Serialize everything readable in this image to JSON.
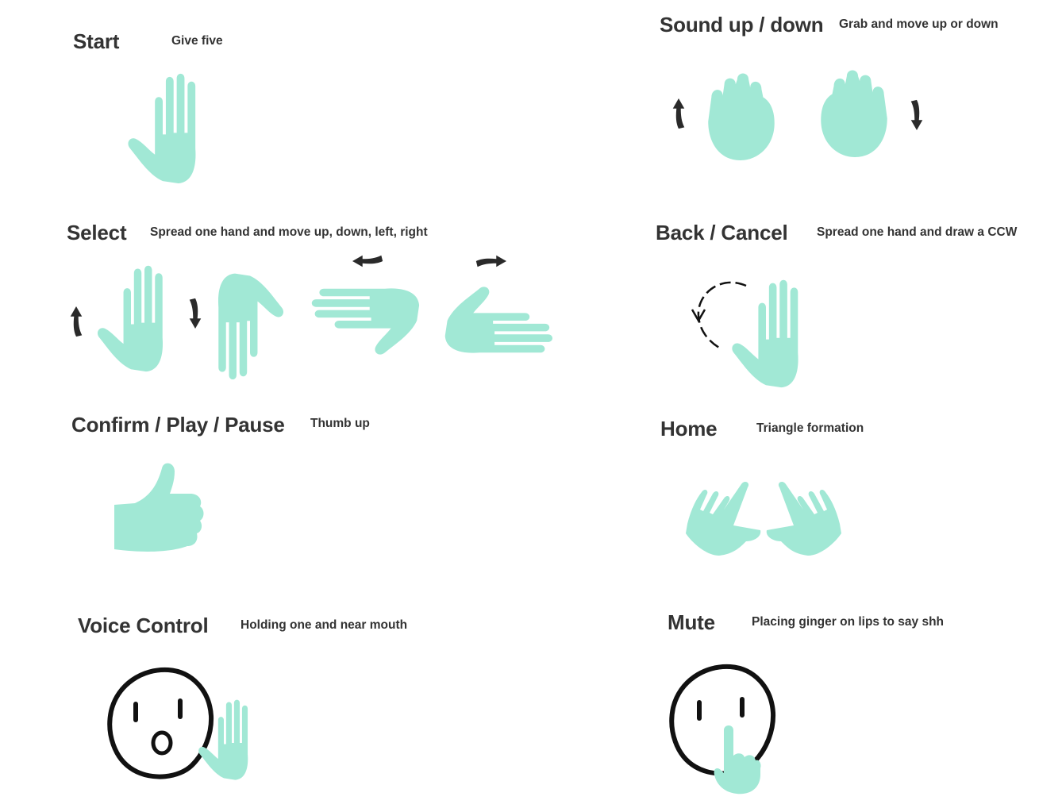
{
  "colors": {
    "hand": "#a1e8d5",
    "text": "#333333",
    "arrow": "#2a2a2a",
    "face": "#111111"
  },
  "gestures": [
    {
      "title": "Start",
      "description": "Give five",
      "icons": [
        "open-palm-hand-icon"
      ]
    },
    {
      "title": "Sound up / down",
      "description": "Grab and move up or down",
      "icons": [
        "grab-hand-icon",
        "rotate-up-arrow-icon",
        "rotate-down-arrow-icon"
      ]
    },
    {
      "title": "Select",
      "description": "Spread one hand and move up, down, left, right",
      "icons": [
        "hand-up-icon",
        "hand-down-icon",
        "hand-left-icon",
        "hand-right-icon"
      ]
    },
    {
      "title": "Back / Cancel",
      "description": "Spread one hand and draw a CCW",
      "icons": [
        "open-palm-hand-icon",
        "ccw-circle-arrow-icon"
      ]
    },
    {
      "title": "Confirm / Play / Pause",
      "description": "Thumb up",
      "icons": [
        "thumbs-up-icon"
      ]
    },
    {
      "title": "Home",
      "description": "Triangle formation",
      "icons": [
        "triangle-hands-icon"
      ]
    },
    {
      "title": "Voice Control",
      "description": "Holding one and near mouth",
      "icons": [
        "face-icon",
        "hand-near-mouth-icon"
      ]
    },
    {
      "title": "Mute",
      "description": "Placing ginger on lips to say shh",
      "icons": [
        "face-icon",
        "finger-on-lips-icon"
      ]
    }
  ]
}
